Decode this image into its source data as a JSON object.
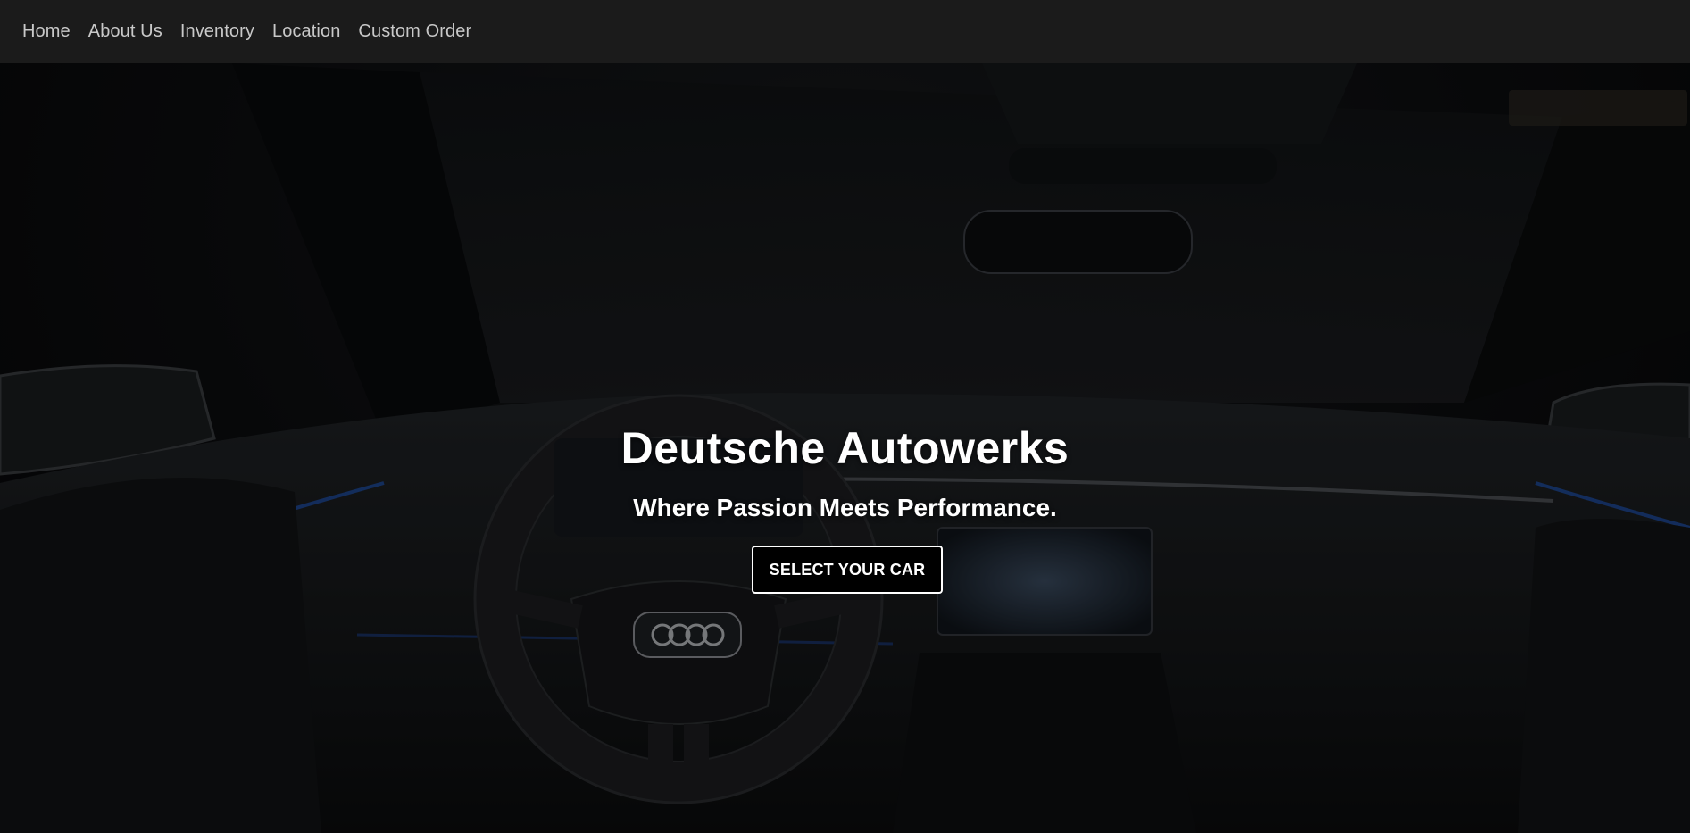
{
  "nav": {
    "items": [
      {
        "label": "Home"
      },
      {
        "label": "About Us"
      },
      {
        "label": "Inventory"
      },
      {
        "label": "Location"
      },
      {
        "label": "Custom Order"
      }
    ]
  },
  "hero": {
    "title": "Deutsche Autowerks",
    "tagline": "Where Passion Meets Performance.",
    "cta_label": "SELECT YOUR CAR",
    "background_image": "car-interior-photo"
  },
  "colors": {
    "navbar_bg": "#1b1b1b",
    "nav_text": "#c9c9c9",
    "hero_text": "#ffffff",
    "ambient_accent": "#1f4fa8",
    "button_bg": "#000000",
    "button_border": "#ffffff"
  }
}
